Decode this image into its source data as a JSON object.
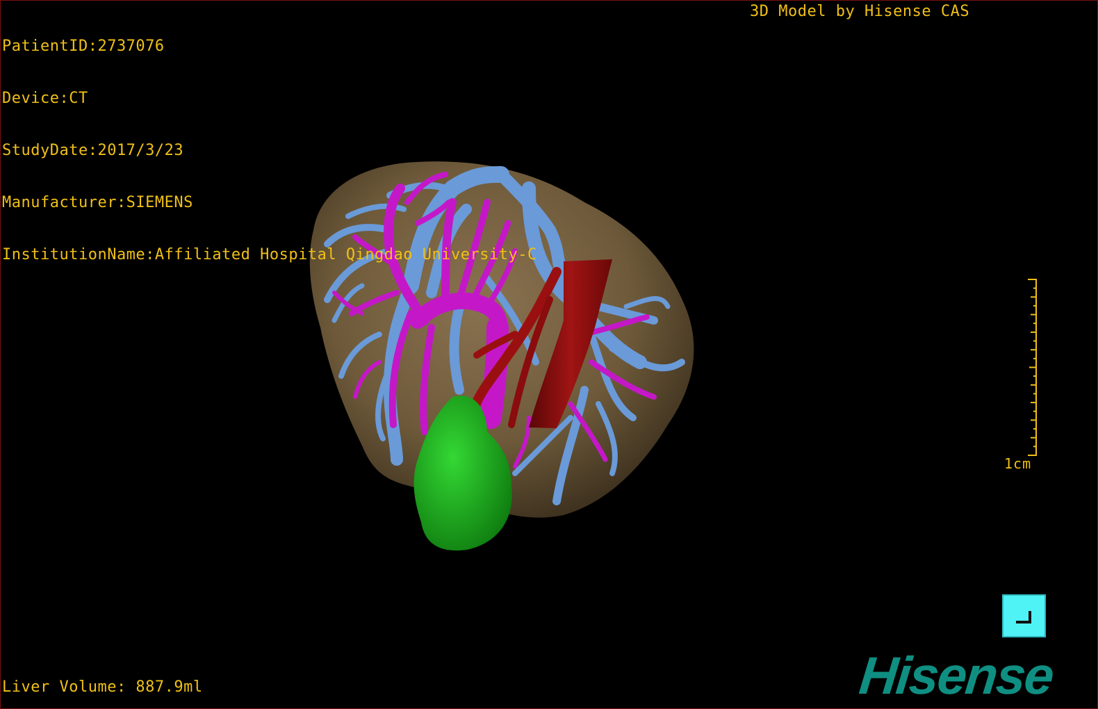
{
  "header": {
    "patient_id": "PatientID:2737076",
    "device": "Device:CT",
    "study_date": "StudyDate:2017/3/23",
    "manufacturer": "Manufacturer:SIEMENS",
    "institution": "InstitutionName:Affiliated Hospital Qingdao University-C"
  },
  "vendor_label": "3D Model by Hisense CAS",
  "footer": {
    "liver_volume": "Liver Volume: 887.9ml"
  },
  "scale": {
    "label": "1cm"
  },
  "brand": {
    "logo_text": "Hisense"
  },
  "model": {
    "structures": [
      {
        "name": "liver",
        "color": "#6e5a3a"
      },
      {
        "name": "hepatic-veins",
        "color": "#6a9ad8"
      },
      {
        "name": "portal-vein",
        "color": "#c418c8"
      },
      {
        "name": "vena-cava",
        "color": "#8c0c0c"
      },
      {
        "name": "tumor",
        "color": "#1ea81e"
      }
    ]
  },
  "colors": {
    "overlay_text": "#f0c018",
    "button": "#4ff2f5",
    "logo": "#0f8f82"
  }
}
